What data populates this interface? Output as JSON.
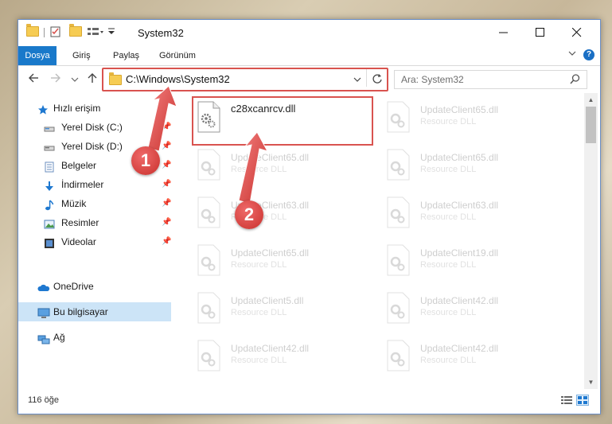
{
  "window": {
    "title": "System32"
  },
  "ribbon": {
    "tabs": [
      "Dosya",
      "Giriş",
      "Paylaş",
      "Görünüm"
    ],
    "help": "?"
  },
  "address": {
    "path": "C:\\Windows\\System32"
  },
  "search": {
    "placeholder": "Ara: System32"
  },
  "sidebar": {
    "items": [
      {
        "label": "Hızlı erişim",
        "icon": "star-icon",
        "pinned": false
      },
      {
        "label": "Yerel Disk (C:)",
        "icon": "drive-icon",
        "pinned": true
      },
      {
        "label": "Yerel Disk (D:)",
        "icon": "drive-icon",
        "pinned": true
      },
      {
        "label": "Belgeler",
        "icon": "documents-icon",
        "pinned": true
      },
      {
        "label": "İndirmeler",
        "icon": "download-icon",
        "pinned": true
      },
      {
        "label": "Müzik",
        "icon": "music-icon",
        "pinned": true
      },
      {
        "label": "Resimler",
        "icon": "pictures-icon",
        "pinned": true
      },
      {
        "label": "Videolar",
        "icon": "video-icon",
        "pinned": true
      },
      {
        "label": "OneDrive",
        "icon": "cloud-icon",
        "pinned": false
      },
      {
        "label": "Bu bilgisayar",
        "icon": "computer-icon",
        "pinned": false,
        "selected": true
      },
      {
        "label": "Ağ",
        "icon": "network-icon",
        "pinned": false
      }
    ]
  },
  "files": {
    "highlighted": {
      "name": "c28xcanrcv.dll"
    },
    "left": [
      {
        "name": "UpdateClient65.dll",
        "type": "Resource DLL"
      },
      {
        "name": "UpdateClient63.dll",
        "type": "Resource DLL"
      },
      {
        "name": "UpdateClient65.dll",
        "type": "Resource DLL"
      },
      {
        "name": "UpdateClient5.dll",
        "type": "Resource DLL"
      },
      {
        "name": "UpdateClient42.dll",
        "type": "Resource DLL"
      }
    ],
    "right": [
      {
        "name": "UpdateClient65.dll",
        "type": "Resource DLL"
      },
      {
        "name": "UpdateClient65.dll",
        "type": "Resource DLL"
      },
      {
        "name": "UpdateClient63.dll",
        "type": "Resource DLL"
      },
      {
        "name": "UpdateClient19.dll",
        "type": "Resource DLL"
      },
      {
        "name": "UpdateClient42.dll",
        "type": "Resource DLL"
      },
      {
        "name": "UpdateClient42.dll",
        "type": "Resource DLL"
      }
    ]
  },
  "status": {
    "count": "116 öğe"
  },
  "callouts": {
    "one": "1",
    "two": "2"
  },
  "colors": {
    "accent": "#1979ca",
    "annotation": "#d9534f"
  }
}
